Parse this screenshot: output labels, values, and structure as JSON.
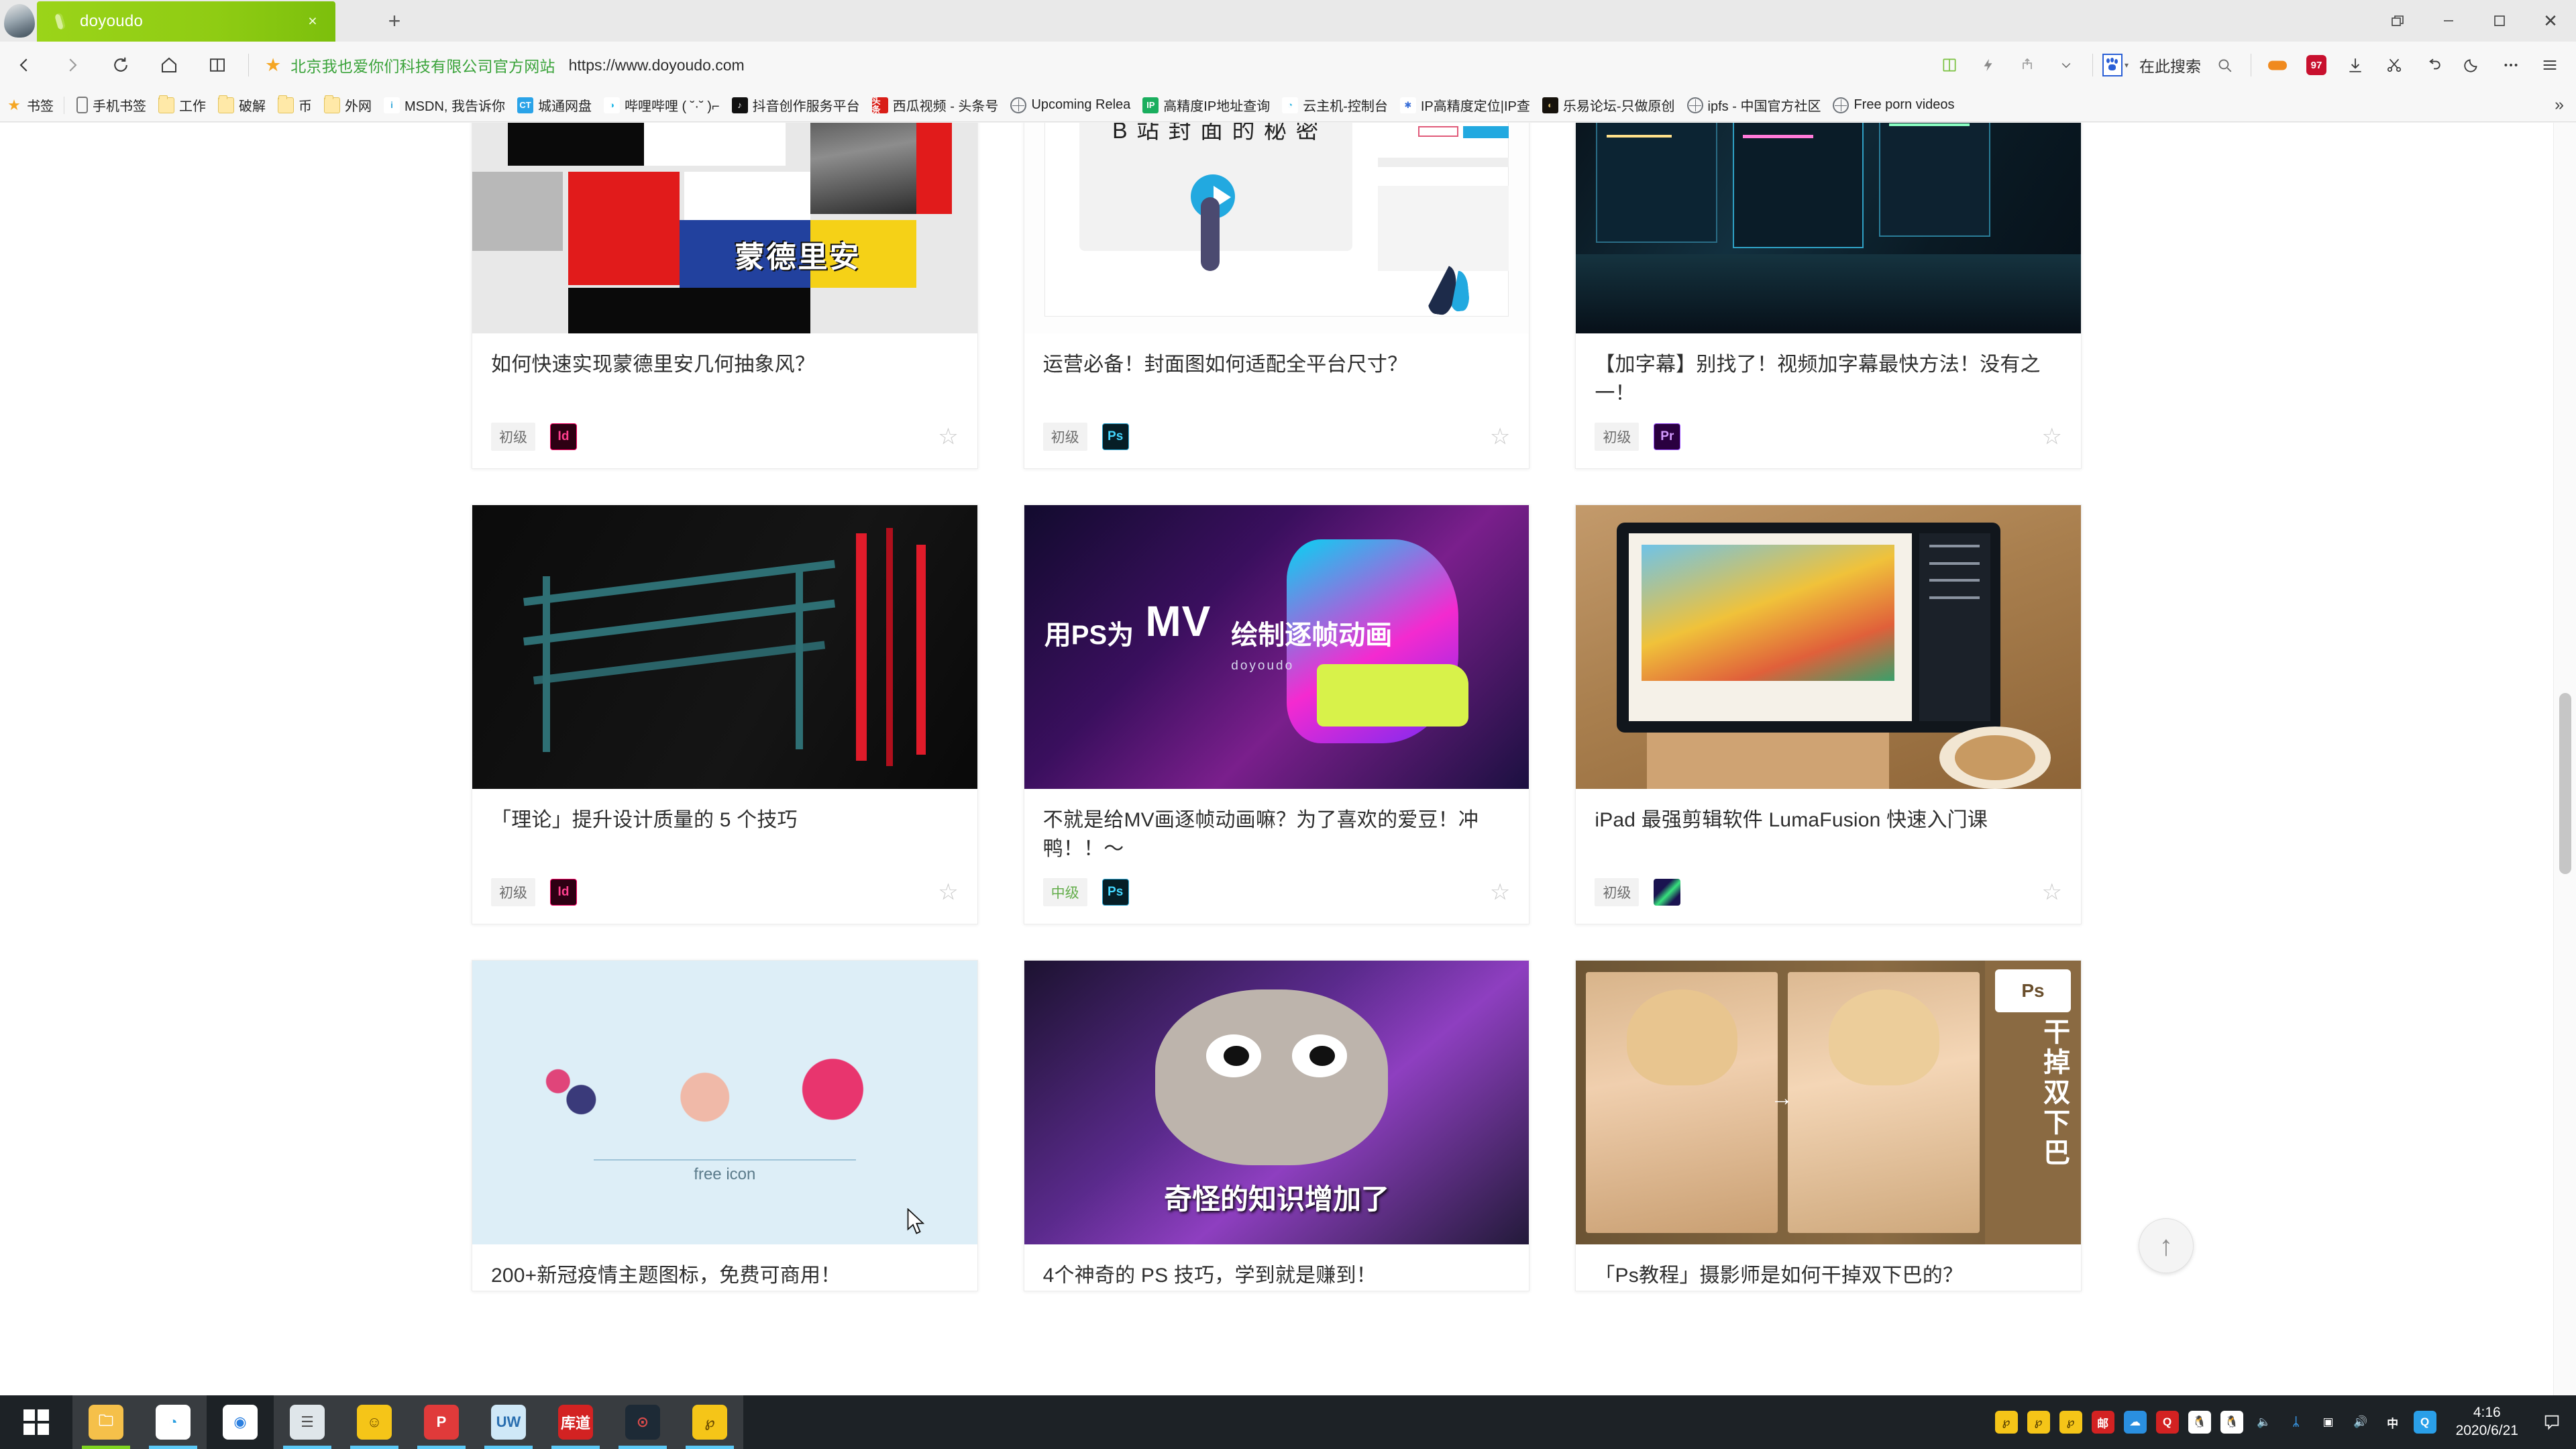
{
  "browser": {
    "tab": {
      "title": "doyoudo",
      "close_label": "×",
      "favicon": "popsicle-icon"
    },
    "new_tab_label": "+",
    "window_controls": {
      "restore": "restore-icon",
      "minimize": "minimize-icon",
      "maximize": "maximize-icon",
      "close": "✕"
    },
    "nav": {
      "back": "back-icon",
      "forward": "forward-icon",
      "reload": "reload-icon",
      "home": "home-icon",
      "reader": "reader-icon"
    },
    "omnibox": {
      "star": "★",
      "site_name": "北京我也爱你们科技有限公司官方网站",
      "url": "https://www.doyoudo.com"
    },
    "toolbar_right": {
      "search_placeholder": "在此搜索",
      "engine_icon": "baidu-paw-icon",
      "items": [
        "book-icon",
        "lightning-icon",
        "share-icon",
        "chevron-down-icon",
        "search-icon",
        "gamepad-icon",
        "wps-icon",
        "download-icon",
        "scissors-icon",
        "undo-icon",
        "moon-icon",
        "more-icon",
        "menu-icon"
      ]
    },
    "bookmarks": [
      {
        "label": "书签",
        "icon": "star-icon",
        "type": "star"
      },
      {
        "label": "手机书签",
        "icon": "phone-icon",
        "type": "phone"
      },
      {
        "label": "工作",
        "icon": "folder-icon",
        "type": "folder"
      },
      {
        "label": "破解",
        "icon": "folder-icon",
        "type": "folder"
      },
      {
        "label": "币",
        "icon": "folder-icon",
        "type": "folder"
      },
      {
        "label": "外网",
        "icon": "folder-icon",
        "type": "folder"
      },
      {
        "label": "MSDN, 我告诉你",
        "icon": "msdn-icon",
        "type": "sq",
        "color": "#ffffff",
        "text": "i",
        "textcolor": "#2aa3d8"
      },
      {
        "label": "城通网盘",
        "icon": "chengtong-icon",
        "type": "sq",
        "color": "#2aa3e8",
        "text": "CT",
        "textcolor": "#ffffff"
      },
      {
        "label": "哔哩哔哩 ( ˘·˘ )⌐",
        "icon": "bilibili-icon",
        "type": "sq",
        "color": "#ffffff",
        "text": "◑",
        "textcolor": "#22b8e8"
      },
      {
        "label": "抖音创作服务平台",
        "icon": "douyin-icon",
        "type": "sq",
        "color": "#111111",
        "text": "♪",
        "textcolor": "#ffffff"
      },
      {
        "label": "西瓜视频 - 头条号",
        "icon": "toutiao-icon",
        "type": "sq",
        "color": "#d91e18",
        "text": "头条",
        "textcolor": "#ffffff"
      },
      {
        "label": "Upcoming Relea",
        "icon": "globe-icon",
        "type": "globe"
      },
      {
        "label": "高精度IP地址查询",
        "icon": "ip-icon",
        "type": "sq",
        "color": "#1aae5e",
        "text": "IP",
        "textcolor": "#ffffff"
      },
      {
        "label": "云主机-控制台",
        "icon": "cloud-icon",
        "type": "sq",
        "color": "#ffffff",
        "text": "◔",
        "textcolor": "#24b1e0"
      },
      {
        "label": "IP高精度定位|IP查",
        "icon": "locate-icon",
        "type": "sq",
        "color": "#ffffff",
        "text": "✱",
        "textcolor": "#3a6fd8"
      },
      {
        "label": "乐易论坛-只做原创",
        "icon": "leyi-icon",
        "type": "sq",
        "color": "#16120c",
        "text": "◐",
        "textcolor": "#d8bb6a"
      },
      {
        "label": "ipfs - 中国官方社区",
        "icon": "globe-icon",
        "type": "globe"
      },
      {
        "label": "Free porn videos",
        "icon": "globe-icon",
        "type": "globe"
      }
    ],
    "bookmarks_overflow": "»"
  },
  "page": {
    "cards": [
      {
        "title": "如何快速实现蒙德里安几何抽象风？",
        "level": "初级",
        "level_kind": "basic",
        "app": "Id",
        "app_class": "badge-id",
        "thumb": "mondrian",
        "thumb_text": "蒙德里安",
        "bookmark": "☆"
      },
      {
        "title": "运营必备！封面图如何适配全平台尺寸？",
        "level": "初级",
        "level_kind": "basic",
        "app": "Ps",
        "app_class": "badge-ps",
        "thumb": "bili",
        "thumb_text": "B 站 封 面 的 秘 密",
        "bookmark": "☆"
      },
      {
        "title": "【加字幕】别找了！视频加字幕最快方法！没有之一！",
        "level": "初级",
        "level_kind": "basic",
        "app": "Pr",
        "app_class": "badge-pr",
        "thumb": "dark-desk",
        "thumb_text": "",
        "bookmark": "☆"
      },
      {
        "title": "「理论」提升设计质量的 5 个技巧",
        "level": "初级",
        "level_kind": "basic",
        "app": "Id",
        "app_class": "badge-id",
        "thumb": "chair",
        "thumb_text": "",
        "bookmark": "☆"
      },
      {
        "title": "不就是给MV画逐帧动画嘛？为了喜欢的爱豆！冲鸭！！～",
        "level": "中级",
        "level_kind": "mid",
        "app": "Ps",
        "app_class": "badge-ps",
        "thumb": "mv",
        "thumb_text": "用PS为 MV 绘制逐帧动画",
        "thumb_sub": "doyoudo",
        "bookmark": "☆"
      },
      {
        "title": "iPad 最强剪辑软件 LumaFusion 快速入门课",
        "level": "初级",
        "level_kind": "basic",
        "app": "LF",
        "app_class": "badge-lf",
        "thumb": "ipad",
        "thumb_text": "",
        "bookmark": "☆"
      },
      {
        "title": "200+新冠疫情主题图标，免费可商用！",
        "level": "",
        "level_kind": "",
        "app": "",
        "app_class": "",
        "thumb": "icons200",
        "thumb_text": "free icon",
        "bookmark": ""
      },
      {
        "title": "4个神奇的 PS 技巧，学到就是赚到！",
        "level": "",
        "level_kind": "",
        "app": "",
        "app_class": "",
        "thumb": "cat",
        "thumb_text": "奇怪的知识增加了",
        "bookmark": ""
      },
      {
        "title": "「Ps教程」摄影师是如何干掉双下巴的？",
        "level": "",
        "level_kind": "",
        "app": "",
        "app_class": "",
        "thumb": "chin",
        "thumb_text": "干掉双下巴",
        "thumb_badge": "Ps",
        "bookmark": ""
      }
    ],
    "back_to_top": "↑"
  },
  "taskbar": {
    "start": "windows-start-icon",
    "pinned": [
      {
        "name": "file-explorer-icon",
        "color": "#f5c04a",
        "text": "🗀",
        "active": true,
        "accent": "green"
      },
      {
        "name": "qq-browser-icon",
        "color": "#ffffff",
        "text": "◔",
        "textcolor": "#2a9fe0",
        "active": true
      },
      {
        "name": "chrome-icon",
        "color": "#ffffff",
        "text": "◉",
        "textcolor": "#2a7fe0",
        "active": false
      },
      {
        "name": "notes-icon",
        "color": "#dfe6ea",
        "text": "☰",
        "textcolor": "#555",
        "active": true
      },
      {
        "name": "potplayer-icon",
        "color": "#f5c518",
        "text": "☺",
        "textcolor": "#6b4b00",
        "active": true
      },
      {
        "name": "pdf-icon",
        "color": "#e03a3a",
        "text": "P",
        "textcolor": "#ffffff",
        "active": true
      },
      {
        "name": "uwp-icon",
        "color": "#cfe8f7",
        "text": "UW",
        "textcolor": "#2a6fb0",
        "active": true
      },
      {
        "name": "youdao-icon",
        "color": "#d32222",
        "text": "库道",
        "textcolor": "#ffffff",
        "active": true
      },
      {
        "name": "davinci-icon",
        "color": "#1d2a36",
        "text": "⊙",
        "textcolor": "#d84b4b",
        "active": true
      },
      {
        "name": "potplayer2-icon",
        "color": "#f5c518",
        "text": "℘",
        "textcolor": "#6b4b00",
        "active": true
      }
    ],
    "tray": [
      {
        "name": "potplayer-tray-icon",
        "color": "#f5c518",
        "text": "℘",
        "textcolor": "#5b4300"
      },
      {
        "name": "potplayer-tray2-icon",
        "color": "#f5c518",
        "text": "℘",
        "textcolor": "#5b4300"
      },
      {
        "name": "potplayer-tray3-icon",
        "color": "#f5c518",
        "text": "℘",
        "textcolor": "#5b4300"
      },
      {
        "name": "mail-icon",
        "color": "#d32222",
        "text": "邮",
        "textcolor": "#ffffff"
      },
      {
        "name": "onedrive-icon",
        "color": "#2a8fe0",
        "text": "☁",
        "textcolor": "#ffffff"
      },
      {
        "name": "qq-music-icon",
        "color": "#d32222",
        "text": "Q",
        "textcolor": "#ffffff"
      },
      {
        "name": "qq-penguin-icon",
        "color": "#ffffff",
        "text": "🐧",
        "textcolor": "#222"
      },
      {
        "name": "qq-penguin2-icon",
        "color": "#ffffff",
        "text": "🐧",
        "textcolor": "#222"
      },
      {
        "name": "volume-mute-icon",
        "color": "transparent",
        "text": "🔈",
        "textcolor": "#e8b020"
      },
      {
        "name": "bluetooth-icon",
        "color": "transparent",
        "text": "ᛦ",
        "textcolor": "#3aa0f5"
      },
      {
        "name": "network-icon",
        "color": "transparent",
        "text": "▣",
        "textcolor": "#ffffff"
      },
      {
        "name": "speaker-icon",
        "color": "transparent",
        "text": "🔊",
        "textcolor": "#ffffff"
      },
      {
        "name": "ime-chinese-icon",
        "color": "transparent",
        "text": "中",
        "textcolor": "#ffffff"
      },
      {
        "name": "qq-tray-icon",
        "color": "#2a9fe8",
        "text": "Q",
        "textcolor": "#ffffff"
      }
    ],
    "clock": {
      "time": "4:16",
      "date": "2020/6/21"
    },
    "action_center": "notification-icon"
  }
}
